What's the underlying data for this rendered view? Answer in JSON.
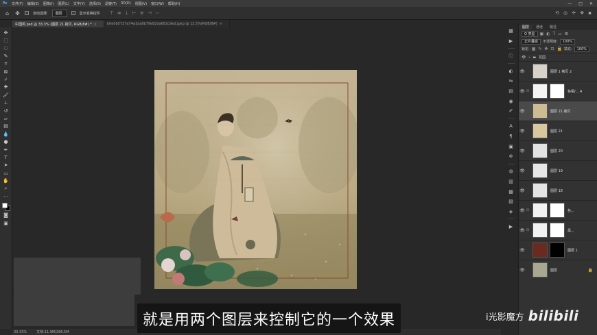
{
  "menubar": {
    "logo": "Ps",
    "items": [
      "文件(F)",
      "编辑(E)",
      "图像(I)",
      "图层(L)",
      "文字(Y)",
      "选择(S)",
      "滤镜(T)",
      "3D(D)",
      "视图(V)",
      "窗口(W)",
      "帮助(H)"
    ],
    "window_controls": [
      "—",
      "□",
      "✕"
    ]
  },
  "options": {
    "auto_select_label": "自动选择:",
    "auto_select_value": "图层",
    "show_transform_label": "显示变换控件"
  },
  "tabs": [
    {
      "label": "中国风.psd @ 33.3% (图层 21 拷贝, RGB/8#) *",
      "active": true
    },
    {
      "label": "b0e0b5727a74a1da8b79e82da682c9ed.jpeg @ 12.5%(RGB/8#)",
      "active": false
    }
  ],
  "status": {
    "zoom": "33.33%",
    "doc_size": "文档:11.9M/286.5M"
  },
  "layers_panel": {
    "tabs": [
      "图层",
      "通道",
      "路径"
    ],
    "kind_label": "Q 类型",
    "blend_mode": "正片叠底",
    "opacity_label": "不透明度:",
    "opacity_value": "100%",
    "lock_label": "锁定:",
    "fill_label": "填充:",
    "fill_value": "100%",
    "group_name": "花园",
    "layers": [
      {
        "name": "图层 1 拷贝 2",
        "thumb_color": "#d8d2c8",
        "has_mask": false,
        "selected": false
      },
      {
        "name": "色相/... 4",
        "thumb_color": "#f4f4f4",
        "has_mask": true,
        "mask_color": "#ffffff",
        "selected": false,
        "adjustment": true
      },
      {
        "name": "图层 21 拷贝",
        "thumb_color": "#cdbb94",
        "has_mask": false,
        "selected": true
      },
      {
        "name": "图层 21",
        "thumb_color": "#d9c7a0",
        "has_mask": false,
        "selected": false
      },
      {
        "name": "图层 20",
        "thumb_color": "#e2e2e2",
        "has_mask": false,
        "selected": false
      },
      {
        "name": "图层 19",
        "thumb_color": "#e6e6e6",
        "has_mask": false,
        "selected": false
      },
      {
        "name": "图层 18",
        "thumb_color": "#e4e4e4",
        "has_mask": false,
        "selected": false
      },
      {
        "name": "色...",
        "thumb_color": "#f2f2f2",
        "has_mask": true,
        "mask_color": "#ffffff",
        "selected": false,
        "adjustment": true
      },
      {
        "name": "黑...",
        "thumb_color": "#f2f2f2",
        "has_mask": true,
        "mask_color": "#ffffff",
        "selected": false,
        "adjustment": true
      },
      {
        "name": "图层 1",
        "thumb_color": "#6a2a20",
        "has_mask": true,
        "mask_color": "#000000",
        "selected": false
      },
      {
        "name": "图层",
        "thumb_color": "#a8a890",
        "has_mask": false,
        "selected": false,
        "locked": true
      }
    ]
  },
  "subtitle": "就是用两个图层来控制它的一个效果",
  "watermark": {
    "channel": "i光影魔方",
    "logo": "bilibili"
  }
}
